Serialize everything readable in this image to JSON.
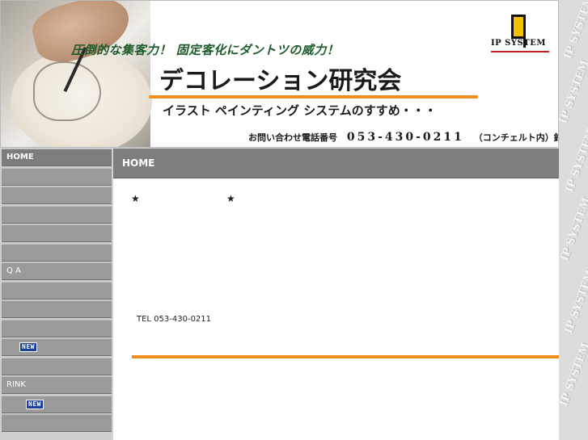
{
  "header": {
    "catchphrase": "圧倒的な集客力！ 固定客化にダントツの威力！",
    "title": "デコレーション研究会",
    "subtitle": "イラスト ペインティング システムのすすめ・・・",
    "contact_prefix": "お問い合わせ電話番号",
    "contact_number": "053-430-0211",
    "contact_suffix": "（コンチェルト内）鈴木まで",
    "logo_text": "IP SYSTEM"
  },
  "watermark": "IP SYSTEM",
  "sidebar": {
    "items": [
      {
        "label": "HOME",
        "active": true
      },
      {
        "label": ""
      },
      {
        "label": ""
      },
      {
        "label": ""
      },
      {
        "label": ""
      },
      {
        "label": ""
      },
      {
        "label": "Q A"
      },
      {
        "label": ""
      },
      {
        "label": ""
      },
      {
        "label": ""
      },
      {
        "label": "",
        "badge": "NEW"
      },
      {
        "label": ""
      },
      {
        "label": "RINK"
      },
      {
        "label": "",
        "badge": "NEW"
      }
    ]
  },
  "content": {
    "heading": "HOME",
    "star1": "★",
    "star2": "★",
    "tel": "TEL 053-430-0211"
  },
  "colors": {
    "accent": "#f08c1a",
    "nav_bg": "#9a9a9a",
    "head_bg": "#7e7e7e",
    "badge": "#1b3f9e"
  }
}
